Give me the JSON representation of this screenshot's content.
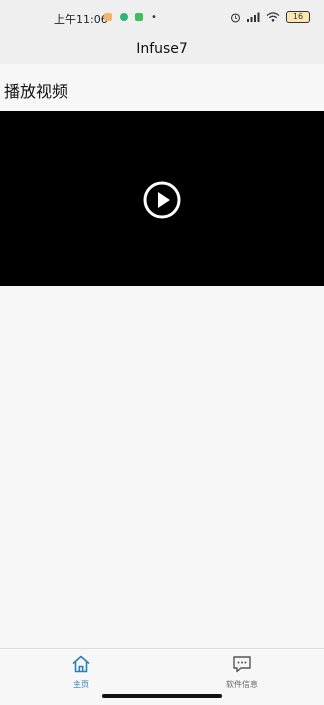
{
  "status_bar": {
    "time": "上午11:06",
    "dot": "•",
    "battery": "16"
  },
  "header": {
    "title": "Infuse7"
  },
  "main": {
    "section_title": "播放视频"
  },
  "tabs": [
    {
      "label": "主页",
      "icon": "home-icon",
      "active": true
    },
    {
      "label": "软件信息",
      "icon": "message-icon",
      "active": false
    }
  ],
  "colors": {
    "active_tab": "#2c7fb8",
    "inactive_tab": "#666666",
    "video_background": "#000000"
  }
}
